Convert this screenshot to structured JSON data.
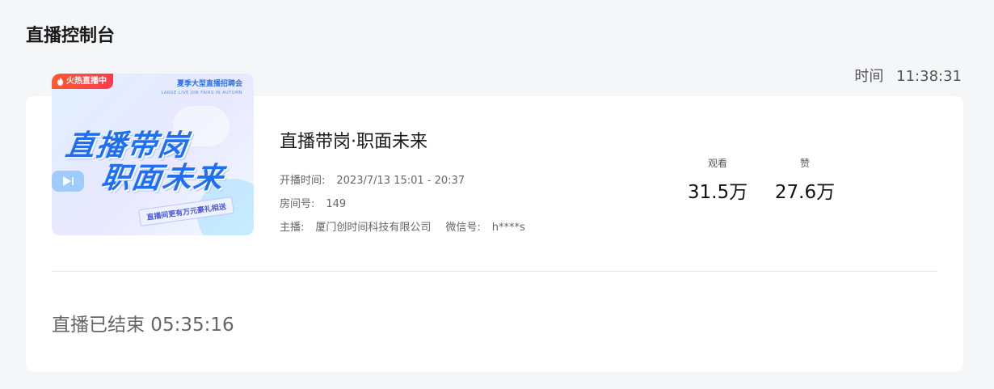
{
  "header": {
    "title": "直播控制台"
  },
  "clock": {
    "label": "时间",
    "value": "11:38:31"
  },
  "cover": {
    "badge": "火热直播中",
    "topline": "夏季大型直播招聘会",
    "topline_en": "LARGE LIVE JOB FAIRS IN AUTUMN",
    "title_line1": "直播带岗",
    "title_line2": "职面未来",
    "ribbon": "直播间更有万元豪礼相送"
  },
  "live": {
    "title": "直播带岗·职面未来",
    "time_label": "开播时间:",
    "time_value": "2023/7/13 15:01 - 20:37",
    "room_label": "房间号:",
    "room_value": "149",
    "host_label": "主播:",
    "host_value": "厦门创时间科技有限公司",
    "wechat_label": "微信号:",
    "wechat_value": "h****s"
  },
  "stats": {
    "views_label": "观看",
    "views_value": "31.5万",
    "likes_label": "赞",
    "likes_value": "27.6万"
  },
  "status": {
    "text": "直播已结束 05:35:16"
  }
}
